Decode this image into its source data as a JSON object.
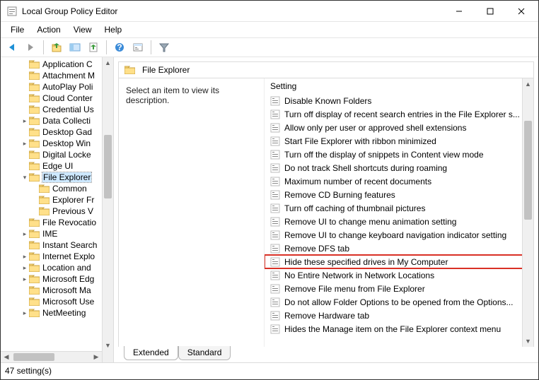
{
  "window": {
    "title": "Local Group Policy Editor"
  },
  "menu": {
    "file": "File",
    "action": "Action",
    "view": "View",
    "help": "Help"
  },
  "tree": {
    "items": [
      {
        "label": "Application C",
        "depth": 2,
        "exp": ""
      },
      {
        "label": "Attachment M",
        "depth": 2,
        "exp": ""
      },
      {
        "label": "AutoPlay Poli",
        "depth": 2,
        "exp": ""
      },
      {
        "label": "Cloud Conter",
        "depth": 2,
        "exp": ""
      },
      {
        "label": "Credential Us",
        "depth": 2,
        "exp": ""
      },
      {
        "label": "Data Collecti",
        "depth": 2,
        "exp": ">"
      },
      {
        "label": "Desktop Gad",
        "depth": 2,
        "exp": ""
      },
      {
        "label": "Desktop Win",
        "depth": 2,
        "exp": ">"
      },
      {
        "label": "Digital Locke",
        "depth": 2,
        "exp": ""
      },
      {
        "label": "Edge UI",
        "depth": 2,
        "exp": ""
      },
      {
        "label": "File Explorer",
        "depth": 2,
        "exp": "v",
        "selected": true
      },
      {
        "label": "Common",
        "depth": 3,
        "exp": ""
      },
      {
        "label": "Explorer Fr",
        "depth": 3,
        "exp": ""
      },
      {
        "label": "Previous V",
        "depth": 3,
        "exp": ""
      },
      {
        "label": "File Revocatio",
        "depth": 2,
        "exp": ""
      },
      {
        "label": "IME",
        "depth": 2,
        "exp": ">"
      },
      {
        "label": "Instant Search",
        "depth": 2,
        "exp": ""
      },
      {
        "label": "Internet Explo",
        "depth": 2,
        "exp": ">"
      },
      {
        "label": "Location and",
        "depth": 2,
        "exp": ">"
      },
      {
        "label": "Microsoft Edg",
        "depth": 2,
        "exp": ">"
      },
      {
        "label": "Microsoft Ma",
        "depth": 2,
        "exp": ""
      },
      {
        "label": "Microsoft Use",
        "depth": 2,
        "exp": ""
      },
      {
        "label": "NetMeeting",
        "depth": 2,
        "exp": ">"
      }
    ]
  },
  "detail": {
    "header": "File Explorer",
    "description": "Select an item to view its description.",
    "column_header": "Setting",
    "settings": [
      "Disable Known Folders",
      "Turn off display of recent search entries in the File Explorer s...",
      "Allow only per user or approved shell extensions",
      "Start File Explorer with ribbon minimized",
      "Turn off the display of snippets in Content view mode",
      "Do not track Shell shortcuts during roaming",
      "Maximum number of recent documents",
      "Remove CD Burning features",
      "Turn off caching of thumbnail pictures",
      "Remove UI to change menu animation setting",
      "Remove UI to change keyboard navigation indicator setting",
      "Remove DFS tab",
      "Hide these specified drives in My Computer",
      "No Entire Network in Network Locations",
      "Remove File menu from File Explorer",
      "Do not allow Folder Options to be opened from the Options...",
      "Remove Hardware tab",
      "Hides the Manage item on the File Explorer context menu"
    ],
    "highlight_index": 12,
    "tabs": {
      "extended": "Extended",
      "standard": "Standard"
    }
  },
  "status": {
    "text": "47 setting(s)"
  }
}
